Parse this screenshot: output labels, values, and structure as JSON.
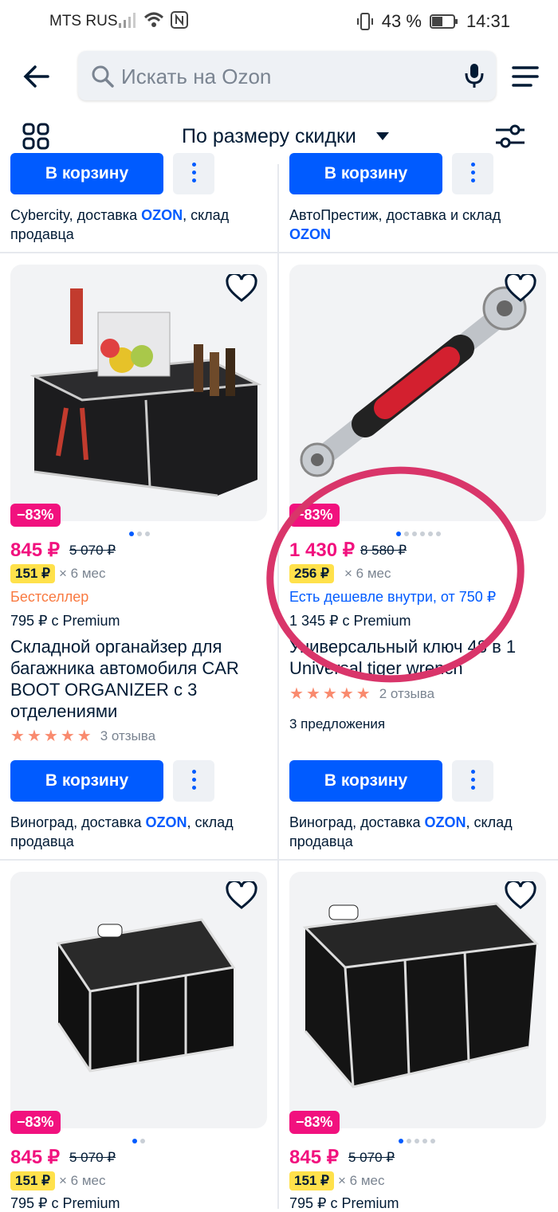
{
  "status": {
    "carrier": "MTS RUS",
    "battery": "43 %",
    "time": "14:31"
  },
  "search": {
    "placeholder": "Искать на Ozon"
  },
  "sort": {
    "label": "По размеру скидки"
  },
  "top_row": [
    {
      "cart": "В корзину",
      "seller_pre": "Cybercity, доставка ",
      "seller_ozon": "OZON",
      "seller_post": ", склад продавца"
    },
    {
      "cart": "В корзину",
      "seller_pre": "АвтоПрестиж, доставка и склад ",
      "seller_ozon": "OZON",
      "seller_post": ""
    }
  ],
  "products": [
    {
      "discount": "−83%",
      "price": "845 ₽",
      "old_price": "5 070 ₽",
      "installment": "151 ₽",
      "term": "× 6 мес",
      "badge": "Бестселлер",
      "premium": "795 ₽ с Premium",
      "title": "Складной органайзер для багажника автомобиля CAR BOOT ORGANIZER с 3 отделениями",
      "rating": 5,
      "reviews": "3 отзыва",
      "cart": "В корзину",
      "seller_pre": "Виноград, доставка ",
      "seller_ozon": "OZON",
      "seller_post": ", склад продавца"
    },
    {
      "discount": "−83%",
      "price": "1 430 ₽",
      "old_price": "8 580 ₽",
      "installment": "256 ₽",
      "term": "× 6 мес",
      "cheaper": "Есть дешевле внутри, от 750 ₽",
      "premium": "1 345 ₽ с Premium",
      "title": "Универсальный ключ 48 в 1 Universal tiger wrench",
      "rating": 5,
      "reviews": "2 отзыва",
      "offers": "3 предложения",
      "cart": "В корзину",
      "seller_pre": "Виноград, доставка ",
      "seller_ozon": "OZON",
      "seller_post": ", склад продавца"
    },
    {
      "discount": "−83%",
      "price": "845 ₽",
      "old_price": "5 070 ₽",
      "installment": "151 ₽",
      "term": "× 6 мес",
      "premium": "795 ₽ с Premium"
    },
    {
      "discount": "−83%",
      "price": "845 ₽",
      "old_price": "5 070 ₽",
      "installment": "151 ₽",
      "term": "× 6 мес",
      "premium": "795 ₽ с Premium"
    }
  ]
}
